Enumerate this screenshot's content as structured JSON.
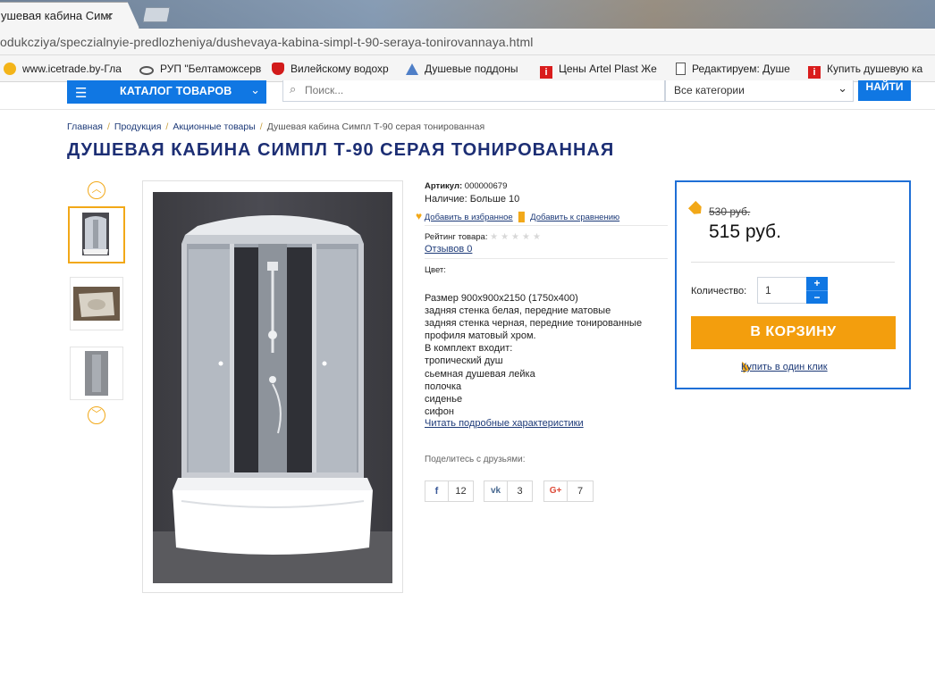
{
  "browser": {
    "tab_title": "ушевая кабина Симпл",
    "tab_close": "×",
    "url": "odukcziya/speczialnyie-predlozheniya/dushevaya-kabina-simpl-t-90-seraya-tonirovannaya.html",
    "bookmarks": [
      {
        "icon": "yellow-circle-icon",
        "label": "www.icetrade.by-Гла"
      },
      {
        "icon": "eye-icon",
        "label": "РУП \"Белтаможсерв"
      },
      {
        "icon": "magnet-icon",
        "label": "Вилейскому водохр"
      },
      {
        "icon": "triangle-icon",
        "label": "Душевые поддоны"
      },
      {
        "icon": "red-i-icon",
        "label": "Цены Artel Plast Же"
      },
      {
        "icon": "document-icon",
        "label": "Редактируем: Душе"
      },
      {
        "icon": "red-i-icon",
        "label": "Купить душевую ка"
      }
    ]
  },
  "header": {
    "catalog_label": "КАТАЛОГ ТОВАРОВ",
    "search_placeholder": "Поиск...",
    "category_select": "Все категории",
    "find_label": "НАЙТИ"
  },
  "breadcrumb": [
    "Главная",
    "Продукция",
    "Акционные товары",
    "Душевая кабина Симпл Т-90 серая тонированная"
  ],
  "product": {
    "title": "ДУШЕВАЯ КАБИНА СИМПЛ Т-90 СЕРАЯ ТОНИРОВАННАЯ",
    "sku_label": "Артикул:",
    "sku": "000000679",
    "stock_label": "Наличие:",
    "stock": "Больше 10",
    "add_favorite": "Добавить в избранное",
    "add_compare": "Добавить к сравнению",
    "rating_label": "Рейтинг товара:",
    "rating": 0,
    "reviews": "Отзывов 0",
    "color_label": "Цвет:",
    "description": [
      "Размер 900x900x2150 (1750x400)",
      "задняя стенка белая, передние матовые",
      "задняя стенка черная, передние тонированные",
      "профиля матовый хром.",
      "В комплект входит:",
      "тропический душ",
      "сьемная душевая лейка",
      "полочка",
      "сиденье",
      "сифон"
    ],
    "read_more": "Читать подробные характеристики",
    "share_label": "Поделитесь с друзьями:",
    "shares": [
      {
        "network": "facebook",
        "icon": "f",
        "count": "12"
      },
      {
        "network": "vk",
        "icon": "vk",
        "count": "3"
      },
      {
        "network": "google-plus",
        "icon": "G+",
        "count": "7"
      }
    ]
  },
  "buybox": {
    "old_price": "530 руб.",
    "price": "515 руб.",
    "qty_label": "Количество:",
    "qty": "1",
    "plus": "+",
    "minus": "−",
    "cart_label": "В КОРЗИНУ",
    "one_click": "Купить в один клик"
  },
  "colors": {
    "brand_blue": "#1077e3",
    "title_navy": "#1c2e74",
    "accent_orange": "#f39e0d"
  }
}
